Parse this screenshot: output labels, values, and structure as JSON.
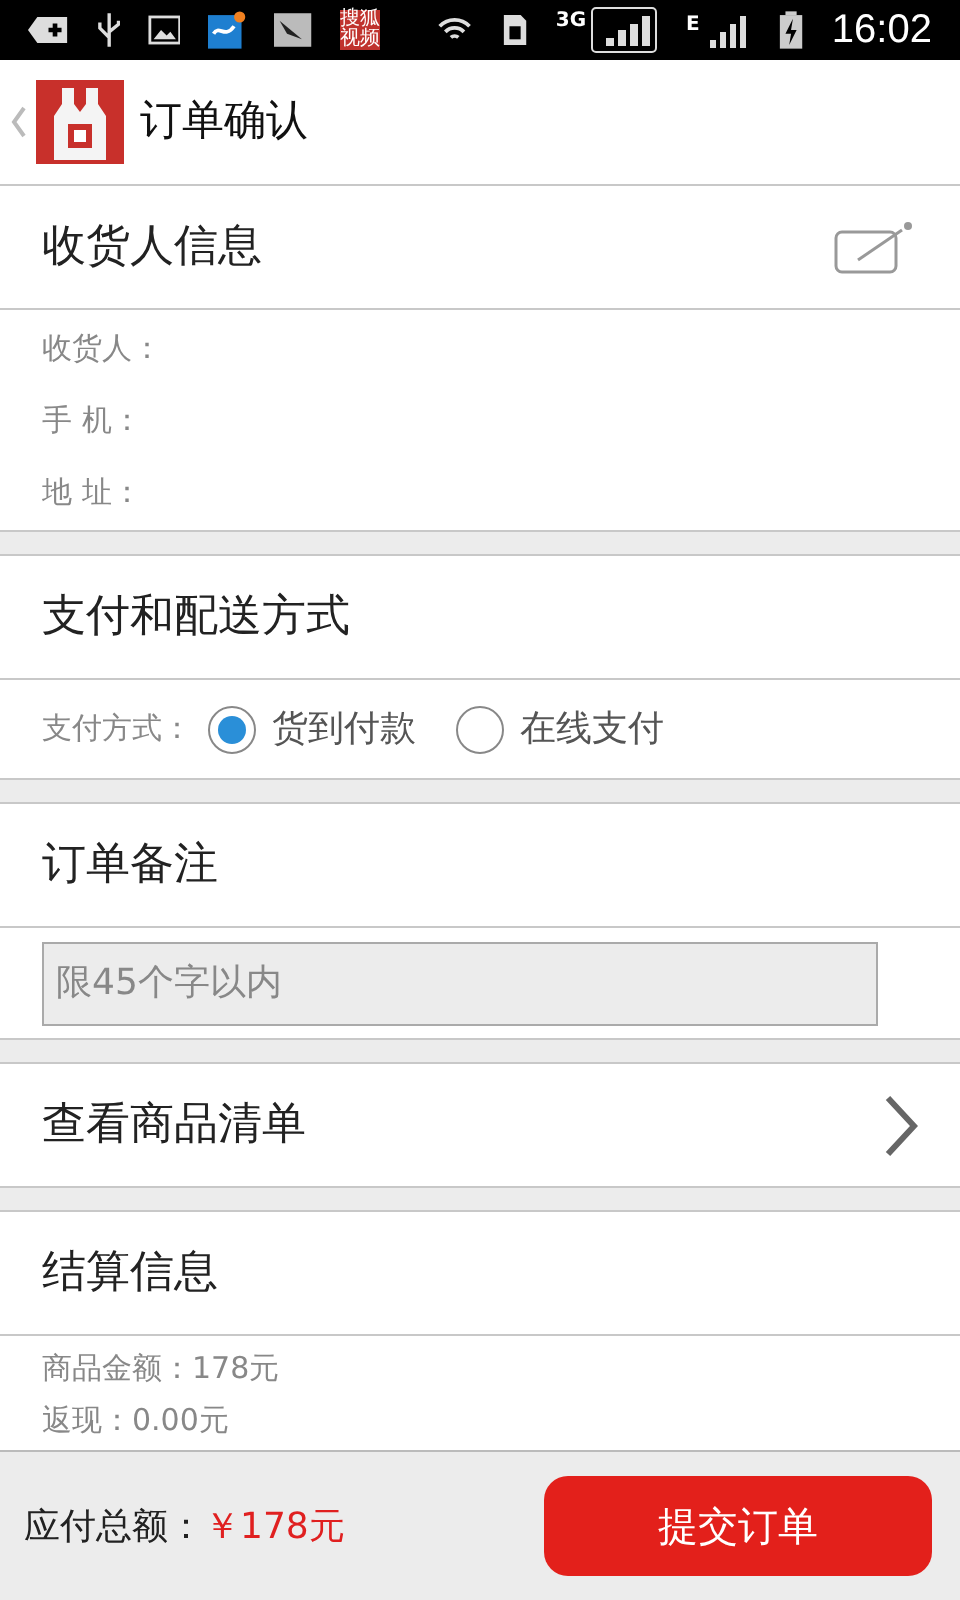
{
  "status_bar": {
    "app_icon_text": [
      "搜狐",
      "视频"
    ],
    "network_3g": "3G",
    "network_e": "E",
    "time": "16:02"
  },
  "header": {
    "title": "订单确认"
  },
  "receiver": {
    "title": "收货人信息",
    "fields": [
      {
        "label": "收货人："
      },
      {
        "label": "手 机："
      },
      {
        "label": "地 址："
      }
    ]
  },
  "payment": {
    "title": "支付和配送方式",
    "label": "支付方式：",
    "options": [
      {
        "label": "货到付款",
        "selected": true
      },
      {
        "label": "在线支付",
        "selected": false
      }
    ]
  },
  "note": {
    "title": "订单备注",
    "placeholder": "限45个字以内"
  },
  "goods_list": {
    "title": "查看商品清单"
  },
  "settlement": {
    "title": "结算信息",
    "rows": [
      "商品金额：178元",
      "返现：0.00元"
    ]
  },
  "footer": {
    "total_label": "应付总额：",
    "total_value": "￥178元",
    "submit": "提交订单"
  }
}
